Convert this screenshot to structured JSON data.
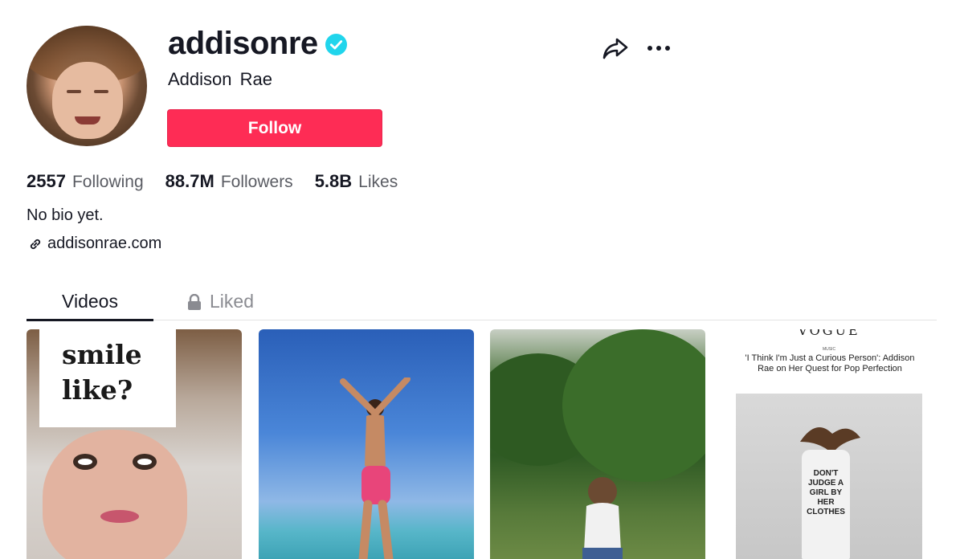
{
  "profile": {
    "username": "addisonre",
    "nickname": "Addison  Rae",
    "follow_label": "Follow",
    "bio": "No bio yet.",
    "link": "addisonrae.com"
  },
  "stats": [
    {
      "value": "2557",
      "label": "Following"
    },
    {
      "value": "88.7M",
      "label": "Followers"
    },
    {
      "value": "5.8B",
      "label": "Likes"
    }
  ],
  "tabs": {
    "videos": "Videos",
    "liked": "Liked"
  },
  "videos": [
    {
      "caption": "smile like?"
    },
    {
      "caption": ""
    },
    {
      "caption": ""
    },
    {
      "masthead": "VOGUE",
      "section": "MUSIC",
      "headline": "'I Think I'm Just a Curious Person': Addison Rae on Her Quest for Pop Perfection",
      "dress_text": "DON'T JUDGE A GIRL BY HER CLOTHES"
    }
  ],
  "colors": {
    "accent": "#fe2c55",
    "verified": "#20d5ec",
    "text": "#161823",
    "muted": "#8a8b91"
  }
}
